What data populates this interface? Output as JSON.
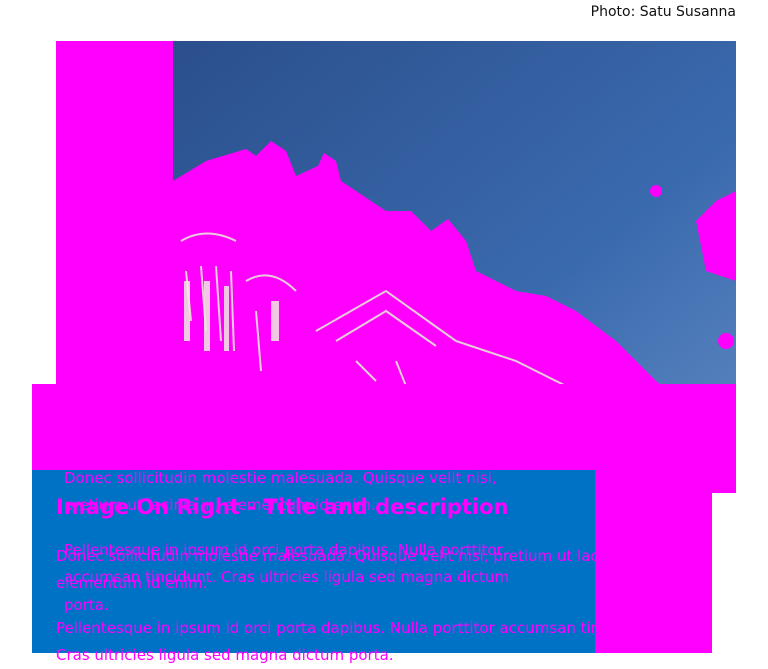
{
  "photo": {
    "credit": "Photo: Satu Susanna",
    "alt": "Helsinki Cathedral"
  },
  "card": {
    "overlay_lines": [
      "Donec sollicitudin molestie malesuada. Quisque velit nisi,",
      "pretium ut lacinia in, elementum id enim.",
      "Pellentesque in ipsum id orci porta dapibus. Nulla porttitor",
      "accumsan tincidunt. Cras ultricies ligula sed magna dictum",
      "porta."
    ],
    "heading": "Image On Right - Title and description",
    "body_lines": [
      "Donec sollicitudin molestie malesuada. Quisque velit nisi, pretium ut lacinia in,",
      "elementum id enim.",
      "Pellentesque in ipsum id orci porta dapibus. Nulla porttitor accumsan tincidunt.",
      "Cras ultricies ligula sed magna dictum porta."
    ]
  },
  "colors": {
    "accent": "#ff00ff",
    "panel": "#0072c6",
    "sky": "#2f5da0"
  }
}
